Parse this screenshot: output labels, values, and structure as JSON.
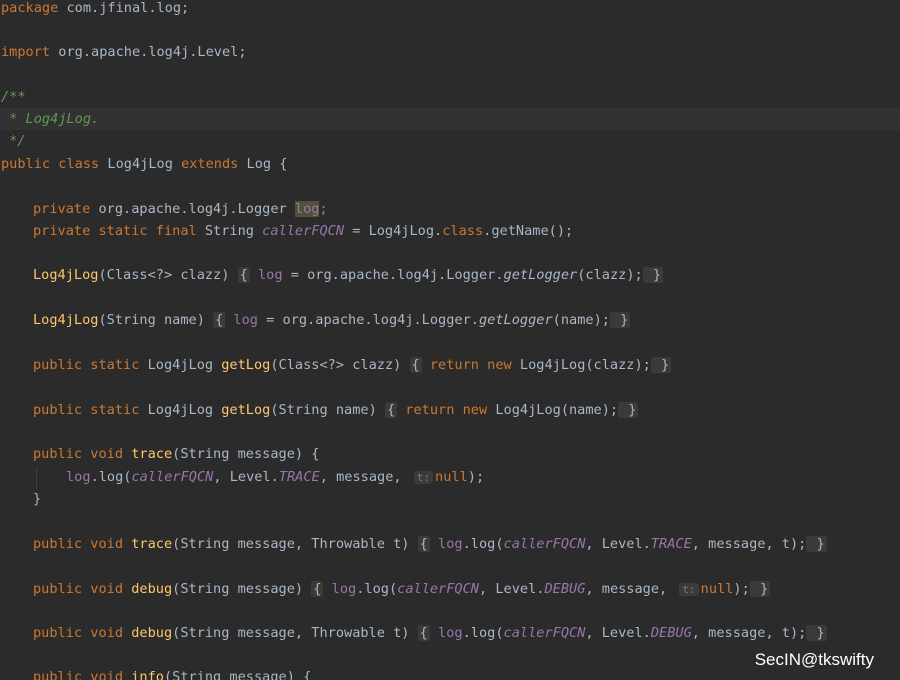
{
  "editor": {
    "lines": {
      "pkg": {
        "kw": "package",
        "rest": " com.jfinal.log;"
      },
      "imp": {
        "kw": "import",
        "rest": " org.apache.log4j.Level;"
      },
      "doc_open": "/**",
      "doc_body": " * Log4jLog.",
      "doc_close": " */",
      "cls": {
        "kw1": "public",
        "kw2": "class",
        "name": " Log4jLog ",
        "kw3": "extends",
        "rest": " Log {"
      },
      "f1": {
        "kw": "private",
        "type": " org.apache.log4j.Logger ",
        "field": "log",
        "end": ";"
      },
      "f2": {
        "kw": "private static final",
        "type": " String ",
        "field": "callerFQCN",
        "mid": " = Log4jLog.",
        "kwc": "class",
        "end": ".getName();"
      },
      "c1": {
        "fn": "Log4jLog",
        "sig": "(Class<?> clazz) ",
        "ob": "{",
        "field": " log",
        "mid": " = org.apache.log4j.Logger.",
        "call": "getLogger",
        "args": "(clazz);",
        "cb": " }"
      },
      "c2": {
        "fn": "Log4jLog",
        "sig": "(String name) ",
        "ob": "{",
        "field": " log",
        "mid": " = org.apache.log4j.Logger.",
        "call": "getLogger",
        "args": "(name);",
        "cb": " }"
      },
      "g1": {
        "kw": "public static",
        "type": " Log4jLog ",
        "fn": "getLog",
        "sig": "(Class<?> clazz) ",
        "ob": "{",
        "kw2": " return new",
        "rest": " Log4jLog(clazz);",
        "cb": " }"
      },
      "g2": {
        "kw": "public static",
        "type": " Log4jLog ",
        "fn": "getLog",
        "sig": "(String name) ",
        "ob": "{",
        "kw2": " return new",
        "rest": " Log4jLog(name);",
        "cb": " }"
      },
      "t1": {
        "kw": "public void",
        "fn": " trace",
        "sig": "(String message) {"
      },
      "t1b": {
        "field": "log",
        "call": ".log(",
        "arg1": "callerFQCN",
        "mid": ", Level.",
        "lvl": "TRACE",
        "rest": ", message, ",
        "hint": "t:",
        "kwn": "null",
        "end": ");"
      },
      "t1c": "}",
      "t2": {
        "kw": "public void",
        "fn": " trace",
        "sig": "(String message, Throwable t) ",
        "ob": "{",
        "field": " log",
        "call": ".log(",
        "arg1": "callerFQCN",
        "mid": ", Level.",
        "lvl": "TRACE",
        "rest": ", message, t);",
        "cb": " }"
      },
      "d1": {
        "kw": "public void",
        "fn": " debug",
        "sig": "(String message) ",
        "ob": "{",
        "field": " log",
        "call": ".log(",
        "arg1": "callerFQCN",
        "mid": ", Level.",
        "lvl": "DEBUG",
        "rest": ", message, ",
        "hint": "t:",
        "kwn": "null",
        "end": ");",
        "cb": " }"
      },
      "d2": {
        "kw": "public void",
        "fn": " debug",
        "sig": "(String message, Throwable t) ",
        "ob": "{",
        "field": " log",
        "call": ".log(",
        "arg1": "callerFQCN",
        "mid": ", Level.",
        "lvl": "DEBUG",
        "rest": ", message, t);",
        "cb": " }"
      },
      "i1": {
        "kw": "public void",
        "fn": " info",
        "sig": "(String message) {"
      }
    }
  },
  "watermark": "SecIN@tkswifty",
  "colors": {
    "background": "#2b2b2b",
    "keyword": "#cc7832",
    "function": "#ffc66d",
    "field": "#9876aa",
    "comment": "#629755",
    "text": "#a9b7c6"
  }
}
